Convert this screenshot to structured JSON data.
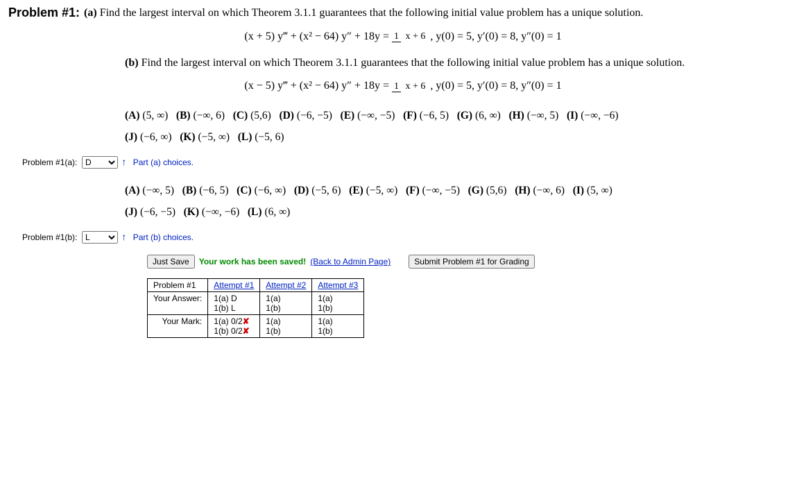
{
  "header": {
    "num": "Problem #1:"
  },
  "partA": {
    "label": "(a)",
    "text": "Find the largest interval on which Theorem 3.1.1 guarantees that the following initial value problem has a unique solution.",
    "eq_lhs": "(x + 5) y‴  +  (x² − 64) y″  +  18y  = ",
    "eq_frac_num": "1",
    "eq_frac_den": "x + 6",
    "eq_rhs": ",    y(0) = 5,  y′(0) = 8,  y″(0) = 1"
  },
  "partB": {
    "label": "(b)",
    "text": "Find the largest interval on which Theorem 3.1.1 guarantees that the following initial value problem has a unique solution.",
    "eq_lhs": "(x − 5) y‴  +  (x² − 64) y″  +  18y  = ",
    "eq_frac_num": "1",
    "eq_frac_den": "x + 6",
    "eq_rhs": ",    y(0) = 5,  y′(0) = 8,  y″(0) = 1"
  },
  "choicesA": {
    "A": "(5, ∞)",
    "B": "(−∞, 6)",
    "C": "(5,6)",
    "D": "(−6, −5)",
    "E": "(−∞, −5)",
    "F": "(−6, 5)",
    "G": "(6, ∞)",
    "H": "(−∞, 5)",
    "I": "(−∞, −6)",
    "J": "(−6, ∞)",
    "K": "(−5, ∞)",
    "L": "(−5, 6)"
  },
  "choicesB": {
    "A": "(−∞, 5)",
    "B": "(−6, 5)",
    "C": "(−6, ∞)",
    "D": "(−5, 6)",
    "E": "(−5, ∞)",
    "F": "(−∞, −5)",
    "G": "(5,6)",
    "H": "(−∞, 6)",
    "I": "(5, ∞)",
    "J": "(−6, −5)",
    "K": "(−∞, −6)",
    "L": "(6, ∞)"
  },
  "inputs": {
    "a_label": "Problem #1(a):",
    "a_value": "D",
    "a_hint": "Part (a) choices.",
    "b_label": "Problem #1(b):",
    "b_value": "L",
    "b_hint": "Part (b) choices."
  },
  "actions": {
    "save": "Just Save",
    "saved_msg": "Your work has been saved!",
    "back_link": "(Back to Admin Page)",
    "submit": "Submit Problem #1 for Grading"
  },
  "attempts": {
    "head": {
      "p": "Problem #1",
      "a1": "Attempt #1",
      "a2": "Attempt #2",
      "a3": "Attempt #3"
    },
    "rows": {
      "ans_label": "Your Answer:",
      "mark_label": "Your Mark:",
      "a1_ans_a": "1(a) D",
      "a1_ans_b": "1(b) L",
      "a2_ans_a": "1(a)",
      "a2_ans_b": "1(b)",
      "a3_ans_a": "1(a)",
      "a3_ans_b": "1(b)",
      "a1_mark_a": "1(a) 0/2",
      "a1_mark_b": "1(b) 0/2",
      "a2_mark_a": "1(a)",
      "a2_mark_b": "1(b)",
      "a3_mark_a": "1(a)",
      "a3_mark_b": "1(b)",
      "x": "✘"
    }
  }
}
